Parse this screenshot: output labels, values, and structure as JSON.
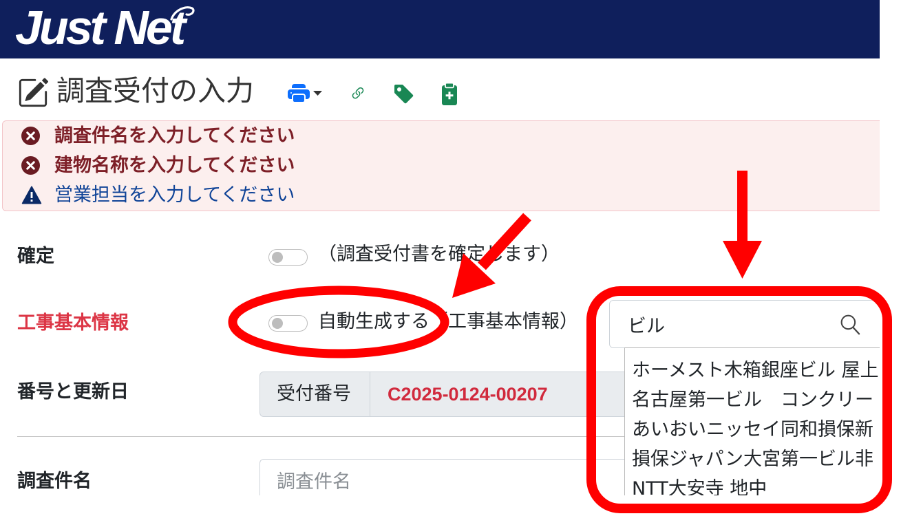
{
  "header": {
    "logo_text": "Just Net"
  },
  "page": {
    "title": "調査受付の入力",
    "title_icon": "edit-icon"
  },
  "toolbar": {
    "buttons": [
      {
        "icon": "print-icon",
        "dropdown_icon": "caret-down-icon"
      },
      {
        "icon": "link-icon"
      },
      {
        "icon": "tag-icon"
      },
      {
        "icon": "clipboard-plus-icon"
      }
    ]
  },
  "alerts": [
    {
      "level": "error",
      "icon": "circle-x-icon",
      "text": "調査件名を入力してください"
    },
    {
      "level": "error",
      "icon": "circle-x-icon",
      "text": "建物名称を入力してください"
    },
    {
      "level": "warning",
      "icon": "warning-triangle-icon",
      "text": "営業担当を入力してください"
    }
  ],
  "form": {
    "confirm": {
      "label": "確定",
      "toggle_checked": false,
      "description": "（調査受付書を確定します）"
    },
    "basic_info": {
      "label": "工事基本情報",
      "toggle_checked": false,
      "toggle_text": "自動生成する（工事基本情報）"
    },
    "building_search": {
      "value": "ビル",
      "icon": "search-icon",
      "results": [
        "ホーメスト木箱銀座ビル 屋上",
        "名古屋第一ビル　コンクリー",
        "あいおいニッセイ同和損保新",
        "損保ジャパン大宮第一ビル非",
        "NTT大安寺 地中"
      ]
    },
    "number": {
      "label": "番号と更新日",
      "addon": "受付番号",
      "value": "C2025-0124-00207"
    },
    "survey_name": {
      "label": "調査件名",
      "placeholder": "調査件名",
      "value": ""
    }
  },
  "colors": {
    "header_bg": "#0f1f5c",
    "print_icon": "#0d6efd",
    "action_icons": "#198754",
    "alert_bg": "#fcefee",
    "error_text": "#7d1f27",
    "warning_text": "#0f4397",
    "required_label": "#dc3545",
    "receipt_number": "#d12a3d",
    "annotation": "#ff0000"
  }
}
